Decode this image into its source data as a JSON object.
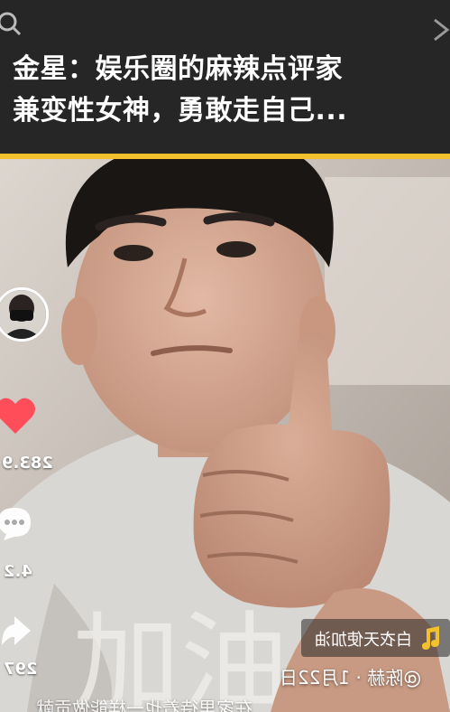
{
  "header": {
    "title_line1": "金星：娱乐圈的麻辣点评家",
    "title_line2": "兼变性女神，勇敢走自己..."
  },
  "colors": {
    "accent": "#f3c12b",
    "header_bg": "#262626",
    "heart": "#ff4d5a"
  },
  "video": {
    "likes": "283.9",
    "comments": "4.2",
    "shares": "297",
    "music": "白衣天使加油",
    "author": "@陈赫 · 1月22日",
    "description": "在家里待着也一样能做贡献"
  }
}
